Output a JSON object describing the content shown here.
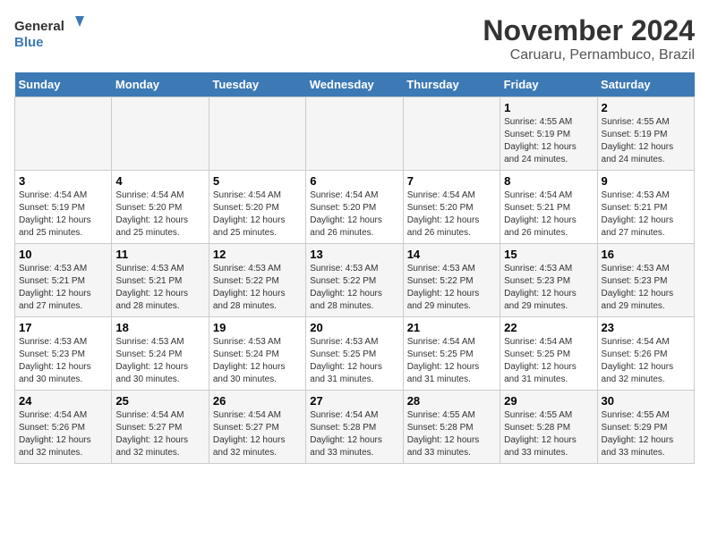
{
  "logo": {
    "line1": "General",
    "line2": "Blue"
  },
  "title": "November 2024",
  "location": "Caruaru, Pernambuco, Brazil",
  "days_header": [
    "Sunday",
    "Monday",
    "Tuesday",
    "Wednesday",
    "Thursday",
    "Friday",
    "Saturday"
  ],
  "weeks": [
    [
      {
        "day": "",
        "info": ""
      },
      {
        "day": "",
        "info": ""
      },
      {
        "day": "",
        "info": ""
      },
      {
        "day": "",
        "info": ""
      },
      {
        "day": "",
        "info": ""
      },
      {
        "day": "1",
        "info": "Sunrise: 4:55 AM\nSunset: 5:19 PM\nDaylight: 12 hours and 24 minutes."
      },
      {
        "day": "2",
        "info": "Sunrise: 4:55 AM\nSunset: 5:19 PM\nDaylight: 12 hours and 24 minutes."
      }
    ],
    [
      {
        "day": "3",
        "info": "Sunrise: 4:54 AM\nSunset: 5:19 PM\nDaylight: 12 hours and 25 minutes."
      },
      {
        "day": "4",
        "info": "Sunrise: 4:54 AM\nSunset: 5:20 PM\nDaylight: 12 hours and 25 minutes."
      },
      {
        "day": "5",
        "info": "Sunrise: 4:54 AM\nSunset: 5:20 PM\nDaylight: 12 hours and 25 minutes."
      },
      {
        "day": "6",
        "info": "Sunrise: 4:54 AM\nSunset: 5:20 PM\nDaylight: 12 hours and 26 minutes."
      },
      {
        "day": "7",
        "info": "Sunrise: 4:54 AM\nSunset: 5:20 PM\nDaylight: 12 hours and 26 minutes."
      },
      {
        "day": "8",
        "info": "Sunrise: 4:54 AM\nSunset: 5:21 PM\nDaylight: 12 hours and 26 minutes."
      },
      {
        "day": "9",
        "info": "Sunrise: 4:53 AM\nSunset: 5:21 PM\nDaylight: 12 hours and 27 minutes."
      }
    ],
    [
      {
        "day": "10",
        "info": "Sunrise: 4:53 AM\nSunset: 5:21 PM\nDaylight: 12 hours and 27 minutes."
      },
      {
        "day": "11",
        "info": "Sunrise: 4:53 AM\nSunset: 5:21 PM\nDaylight: 12 hours and 28 minutes."
      },
      {
        "day": "12",
        "info": "Sunrise: 4:53 AM\nSunset: 5:22 PM\nDaylight: 12 hours and 28 minutes."
      },
      {
        "day": "13",
        "info": "Sunrise: 4:53 AM\nSunset: 5:22 PM\nDaylight: 12 hours and 28 minutes."
      },
      {
        "day": "14",
        "info": "Sunrise: 4:53 AM\nSunset: 5:22 PM\nDaylight: 12 hours and 29 minutes."
      },
      {
        "day": "15",
        "info": "Sunrise: 4:53 AM\nSunset: 5:23 PM\nDaylight: 12 hours and 29 minutes."
      },
      {
        "day": "16",
        "info": "Sunrise: 4:53 AM\nSunset: 5:23 PM\nDaylight: 12 hours and 29 minutes."
      }
    ],
    [
      {
        "day": "17",
        "info": "Sunrise: 4:53 AM\nSunset: 5:23 PM\nDaylight: 12 hours and 30 minutes."
      },
      {
        "day": "18",
        "info": "Sunrise: 4:53 AM\nSunset: 5:24 PM\nDaylight: 12 hours and 30 minutes."
      },
      {
        "day": "19",
        "info": "Sunrise: 4:53 AM\nSunset: 5:24 PM\nDaylight: 12 hours and 30 minutes."
      },
      {
        "day": "20",
        "info": "Sunrise: 4:53 AM\nSunset: 5:25 PM\nDaylight: 12 hours and 31 minutes."
      },
      {
        "day": "21",
        "info": "Sunrise: 4:54 AM\nSunset: 5:25 PM\nDaylight: 12 hours and 31 minutes."
      },
      {
        "day": "22",
        "info": "Sunrise: 4:54 AM\nSunset: 5:25 PM\nDaylight: 12 hours and 31 minutes."
      },
      {
        "day": "23",
        "info": "Sunrise: 4:54 AM\nSunset: 5:26 PM\nDaylight: 12 hours and 32 minutes."
      }
    ],
    [
      {
        "day": "24",
        "info": "Sunrise: 4:54 AM\nSunset: 5:26 PM\nDaylight: 12 hours and 32 minutes."
      },
      {
        "day": "25",
        "info": "Sunrise: 4:54 AM\nSunset: 5:27 PM\nDaylight: 12 hours and 32 minutes."
      },
      {
        "day": "26",
        "info": "Sunrise: 4:54 AM\nSunset: 5:27 PM\nDaylight: 12 hours and 32 minutes."
      },
      {
        "day": "27",
        "info": "Sunrise: 4:54 AM\nSunset: 5:28 PM\nDaylight: 12 hours and 33 minutes."
      },
      {
        "day": "28",
        "info": "Sunrise: 4:55 AM\nSunset: 5:28 PM\nDaylight: 12 hours and 33 minutes."
      },
      {
        "day": "29",
        "info": "Sunrise: 4:55 AM\nSunset: 5:28 PM\nDaylight: 12 hours and 33 minutes."
      },
      {
        "day": "30",
        "info": "Sunrise: 4:55 AM\nSunset: 5:29 PM\nDaylight: 12 hours and 33 minutes."
      }
    ]
  ]
}
